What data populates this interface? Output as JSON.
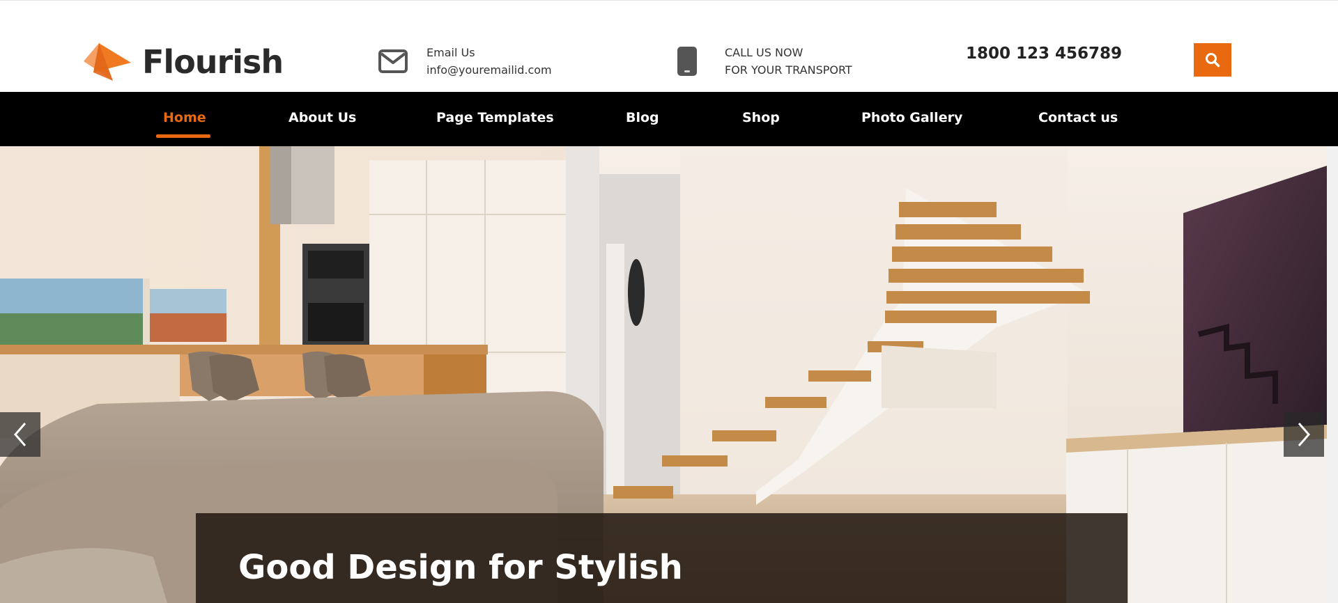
{
  "brand": {
    "name": "Flourish",
    "accent_color": "#e8690f"
  },
  "header": {
    "email": {
      "icon": "envelope-icon",
      "label": "Email Us",
      "value": "info@youremailid.com"
    },
    "call": {
      "icon": "mobile-phone-icon",
      "label": "CALL US NOW",
      "value": "FOR YOUR TRANSPORT"
    },
    "phone_number": "1800 123 456789",
    "search_icon": "search-icon"
  },
  "nav": {
    "items": [
      {
        "label": "Home",
        "active": true
      },
      {
        "label": "About Us"
      },
      {
        "label": "Page Templates"
      },
      {
        "label": "Blog"
      },
      {
        "label": "Shop"
      },
      {
        "label": "Photo Gallery"
      },
      {
        "label": "Contact us"
      }
    ]
  },
  "hero": {
    "caption": "Good Design for Stylish",
    "prev_icon": "chevron-left-icon",
    "next_icon": "chevron-right-icon"
  }
}
